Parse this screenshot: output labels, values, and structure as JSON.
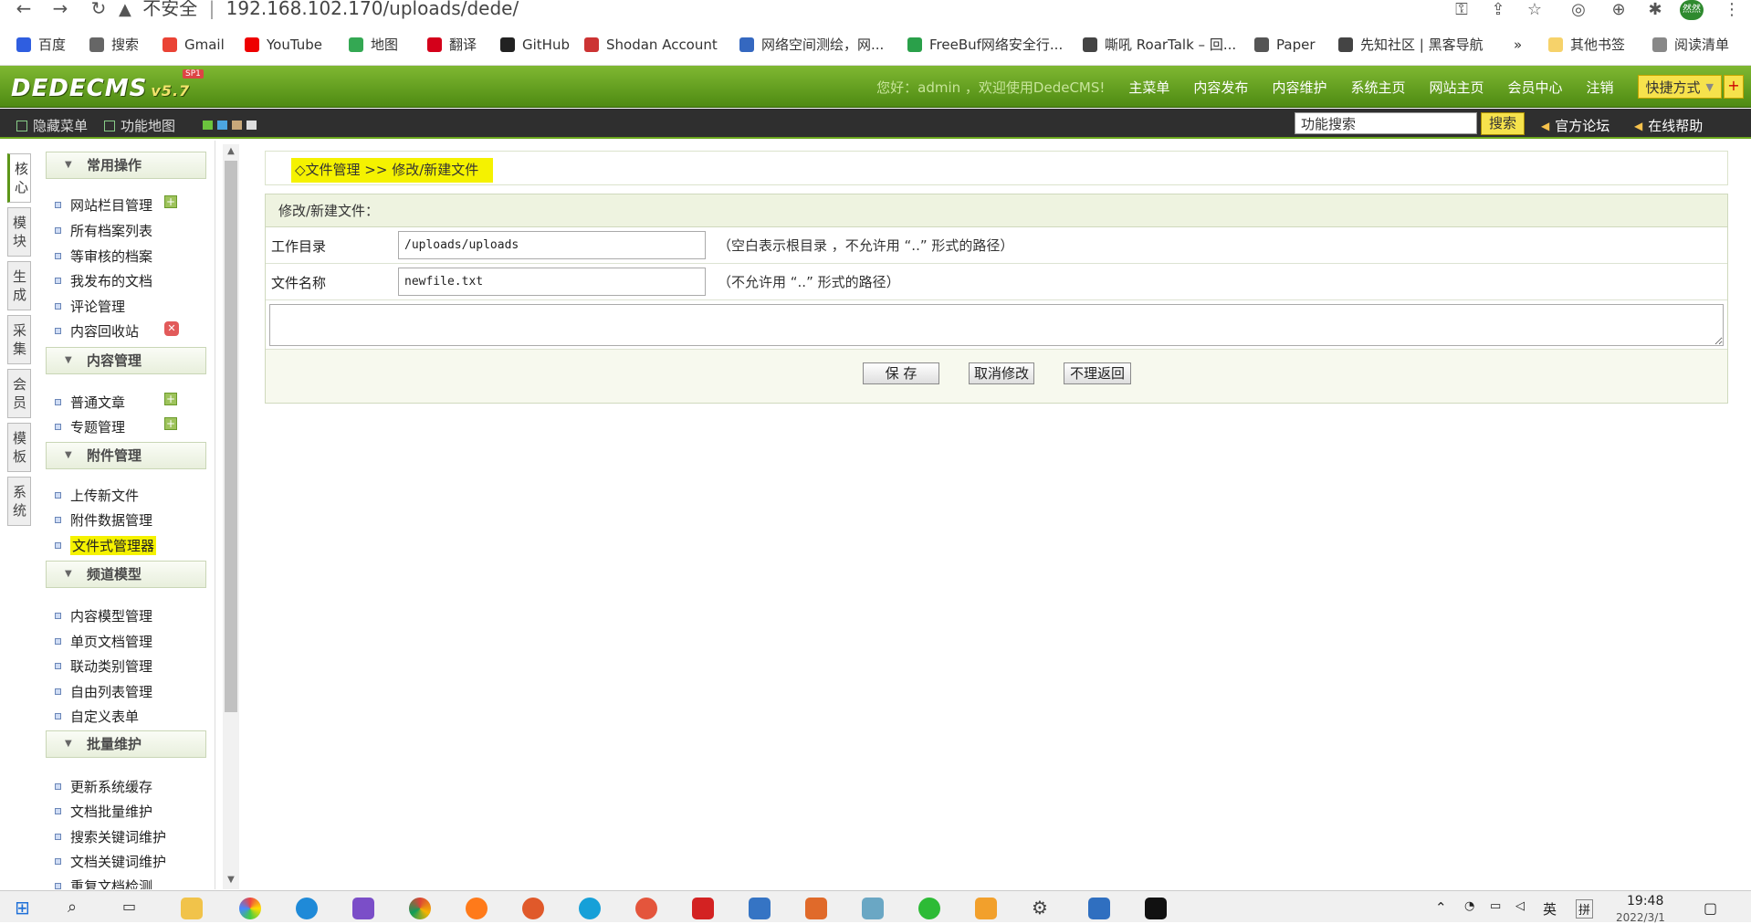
{
  "browser": {
    "warning": "不安全",
    "url": "192.168.102.170/uploads/dede/",
    "avatar": "然然",
    "bookmarks": [
      {
        "label": "百度",
        "color": "#2f5ee0"
      },
      {
        "label": "搜索",
        "color": "#666"
      },
      {
        "label": "Gmail",
        "color": "#ea4335"
      },
      {
        "label": "YouTube",
        "color": "#e00"
      },
      {
        "label": "地图",
        "color": "#34a853"
      },
      {
        "label": "翻译",
        "color": "#d4001a"
      },
      {
        "label": "GitHub",
        "color": "#222"
      },
      {
        "label": "Shodan Account",
        "color": "#c33"
      },
      {
        "label": "网络空间测绘，网...",
        "color": "#3568c0"
      },
      {
        "label": "FreeBuf网络安全行...",
        "color": "#2aa04a"
      },
      {
        "label": "嘶吼 RoarTalk – 回...",
        "color": "#444"
      },
      {
        "label": "Paper",
        "color": "#555"
      },
      {
        "label": "先知社区 | 黑客导航",
        "color": "#444"
      }
    ],
    "more": "»",
    "other_bookmarks": "其他书签",
    "reading_list": "阅读清单"
  },
  "header": {
    "logo": "DEDECMS",
    "version": "v5.7",
    "sp": "SP1",
    "welcome": "您好：admin ，欢迎使用DedeCMS!",
    "menu": [
      "主菜单",
      "内容发布",
      "内容维护",
      "系统主页",
      "网站主页",
      "会员中心",
      "注销"
    ],
    "quick": "快捷方式",
    "quick_plus": "+"
  },
  "subbar": {
    "hide_menu": "隐藏菜单",
    "func_map": "功能地图",
    "search_value": "功能搜索",
    "search_btn": "搜索",
    "forum": "官方论坛",
    "help": "在线帮助"
  },
  "vtabs": [
    "核心",
    "模块",
    "生成",
    "采集",
    "会员",
    "模板",
    "系统"
  ],
  "sidebar": {
    "sections": [
      {
        "title": "常用操作",
        "items": [
          "网站栏目管理",
          "所有档案列表",
          "等审核的档案",
          "我发布的文档",
          "评论管理",
          "内容回收站"
        ]
      },
      {
        "title": "内容管理",
        "items": [
          "普通文章",
          "专题管理"
        ]
      },
      {
        "title": "附件管理",
        "items": [
          "上传新文件",
          "附件数据管理",
          "文件式管理器"
        ]
      },
      {
        "title": "频道模型",
        "items": [
          "内容模型管理",
          "单页文档管理",
          "联动类别管理",
          "自由列表管理",
          "自定义表单"
        ]
      },
      {
        "title": "批量维护",
        "items": [
          "更新系统缓存",
          "文档批量维护",
          "搜索关键词维护",
          "文档关键词维护",
          "重复文档检测"
        ]
      }
    ]
  },
  "main": {
    "crumb": "◇文件管理 >> 修改/新建文件",
    "form_title": "修改/新建文件：",
    "workdir_label": "工作目录",
    "workdir_value": "/uploads/uploads",
    "workdir_note": "（空白表示根目录 ，不允许用 “..” 形式的路径）",
    "filename_label": "文件名称",
    "filename_value": "newfile.txt",
    "filename_note": "（不允许用 “..” 形式的路径）",
    "content_value": "",
    "save": "保 存",
    "cancel": "取消修改",
    "back": "不理返回"
  },
  "taskbar": {
    "ime": "英",
    "ime2": "拼",
    "time": "19:48",
    "date": "2022/3/1"
  }
}
